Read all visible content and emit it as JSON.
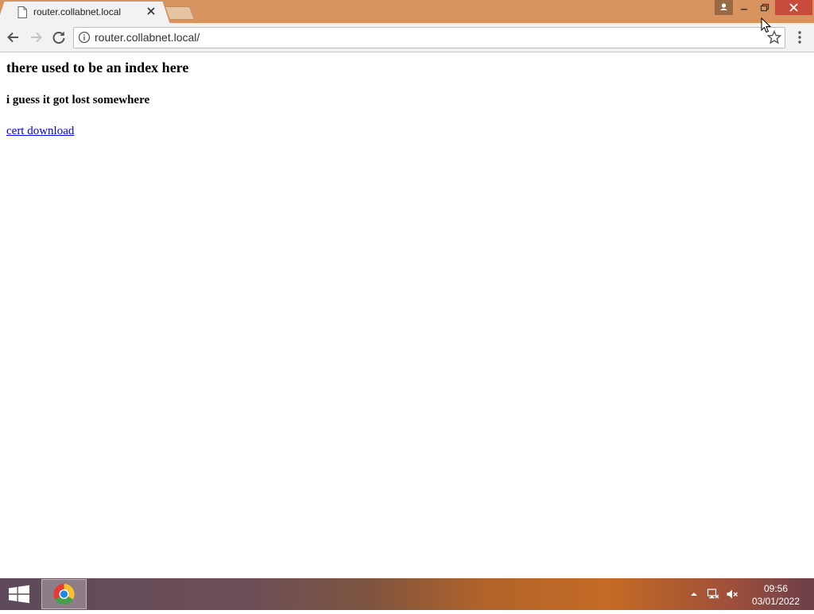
{
  "browser": {
    "tab_title": "router.collabnet.local",
    "url": "router.collabnet.local/"
  },
  "page": {
    "heading": "there used to be an index here",
    "subheading": "i guess it got lost somewhere",
    "link_text": "cert download"
  },
  "taskbar": {
    "time": "09:56",
    "date": "03/01/2022"
  },
  "colors": {
    "titlebar": "#d8935e",
    "close_button": "#c94b3c",
    "link": "#0000ee"
  },
  "icons": [
    "page-icon",
    "tab-close-icon",
    "profile-icon",
    "minimize-icon",
    "maximize-icon",
    "close-icon",
    "back-arrow-icon",
    "forward-arrow-icon",
    "reload-icon",
    "info-icon",
    "star-icon",
    "menu-icon",
    "windows-logo-icon",
    "chrome-icon",
    "tray-up-arrow-icon",
    "network-icon",
    "volume-muted-icon",
    "cursor-icon"
  ]
}
